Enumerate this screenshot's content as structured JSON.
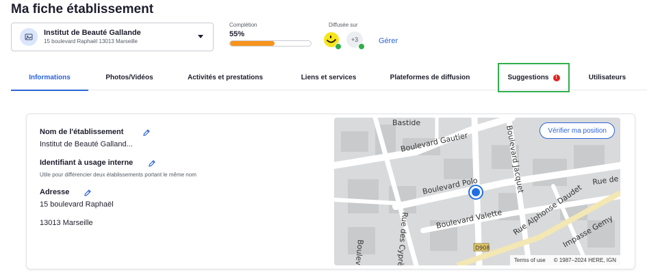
{
  "page": {
    "title": "Ma fiche établissement"
  },
  "establishment": {
    "name": "Institut de Beauté Gallande",
    "address": "15 boulevard Raphaël 13013 Marseille"
  },
  "completion": {
    "label": "Complétion",
    "value_text": "55%",
    "progress": 0.55
  },
  "diffusion": {
    "label": "Diffusée sur",
    "more_count": "+3",
    "manage_label": "Gérer"
  },
  "tabs": [
    {
      "label": "Informations",
      "active": true
    },
    {
      "label": "Photos/Vidéos"
    },
    {
      "label": "Activités et prestations"
    },
    {
      "label": "Liens et services"
    },
    {
      "label": "Plateformes de diffusion"
    },
    {
      "label": "Suggestions",
      "alert": "!"
    },
    {
      "label": "Utilisateurs"
    }
  ],
  "info": {
    "name_title": "Nom de l'établissement",
    "name_value": "Institut de Beauté Galland...",
    "internal_id_title": "Identifiant à usage interne",
    "internal_id_help": "Utile pour différencier deux établissements portant le même nom",
    "address_title": "Adresse",
    "address_line1": "15 boulevard Raphaël",
    "address_line2": "13013 Marseille"
  },
  "map": {
    "verify_label": "Vérifier ma position",
    "terms": "Terms of use",
    "copyright": "© 1987–2024 HERE, IGN",
    "streets": [
      "Bastide",
      "Boulevard Gautier",
      "Boulevard Jacquet",
      "Boulevard Polo",
      "Rue de",
      "Rue Alphonse Daudet",
      "Boulevard Valette",
      "Impasse Gemy",
      "Rue des Cyprès",
      "Boulevard",
      "D908"
    ]
  },
  "colors": {
    "accent": "#2a62d8",
    "progress": "#f7941d",
    "success": "#2fae4a",
    "alert": "#e02424"
  }
}
